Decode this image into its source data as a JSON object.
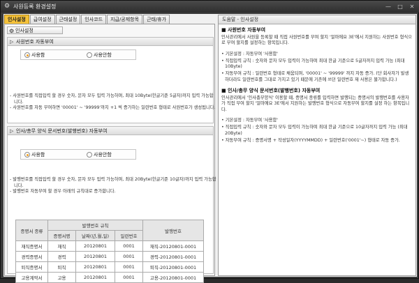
{
  "window": {
    "title": "사원등록 환경설정",
    "controls": [
      "—",
      "□",
      "✕"
    ]
  },
  "tabs": [
    {
      "label": "인사설정",
      "active": true
    },
    {
      "label": "급여설정",
      "active": false
    },
    {
      "label": "근태설정",
      "active": false
    },
    {
      "label": "인사코드",
      "active": false
    },
    {
      "label": "지급/공제항목",
      "active": false
    },
    {
      "label": "근태/휴가",
      "active": false
    }
  ],
  "left": {
    "section_title": "인사설정",
    "group1": {
      "title": "사원번호 자동부여",
      "radio_use": "사용함",
      "radio_nouse": "사용안함",
      "selected": "사용함",
      "notes": [
        "- 사원번호를 직접입력 할 경우 숫자, 문자 모두 입력 가능하며, 최대 10Byte(한글기준 5글자)까지 입력 가능합니다.",
        "- 사원번호를 자동 부여하면 '00001' ~ '99999'까지 +1 씩 증가하는 일련번호 형태로 사원번호가 생성됩니다."
      ]
    },
    "group2": {
      "title": "인사/총무 양식 문서번호(발행번호) 자동부여",
      "radio_use": "사용함",
      "radio_nouse": "사용안함",
      "selected": "사용함",
      "notes": [
        "- 발행번호를 직접입력 할 경우 숫자, 문자 모두 입력 가능하며, 최대 20Byte(한글기준 10글자)까지 입력 가능합니다.",
        "- 발행번호 자동부여 할 경우 아래의 규칙대로 증가합니다."
      ],
      "table": {
        "h_kind": "증명서 종류",
        "h_rule": "발행번호 규칙",
        "h_num": "발행번호",
        "h_short": "증명서명",
        "h_date": "날짜(년,월,일)",
        "h_serial": "일련번호",
        "rows": [
          {
            "kind": "재직증명서",
            "short": "재직",
            "date": "20120801",
            "serial": "0001",
            "num": "재직-20120801-0001"
          },
          {
            "kind": "경력증명서",
            "short": "경력",
            "date": "20120801",
            "serial": "0001",
            "num": "경력-20120801-0001"
          },
          {
            "kind": "퇴직증명서",
            "short": "퇴직",
            "date": "20120801",
            "serial": "0001",
            "num": "퇴직-20120801-0001"
          },
          {
            "kind": "고용계약서",
            "short": "고용",
            "date": "20120801",
            "serial": "0001",
            "num": "고용-20120801-0001"
          }
        ]
      }
    }
  },
  "help": {
    "title": "도움말 - 인사설정",
    "s1_title": "■ 사원번호 자동부여",
    "s1_desc": "인사관리에서 사원을 등록할 때 직접 사원번호를 부여 할지 '얼마에요 3E'에서 지원하는 사원번호 형식으로 부여 할지를 설정하는 항목입니다.",
    "s1_items": [
      "• 기본설정 : 자동부여 '사용함'",
      "• 직접입력 규칙 : 숫자와 문자 모두 입력이 가능하며 최대 한글 기준으로 5글자까지 입력 가능 (최대10Byte)",
      "• 자동부여 규칙 : 일련번호 형태로 채움되며, '00001' ~ '99999' 까지 자동 증가. (단 회사자가 발생하더라도 일련번호를 그대로 가지고 있기 때문에 기존에 쓰던 일련번호 재 사용은 불가합니다.)"
    ],
    "s2_title": "■ 인사/총무 양식 문서번호(발행번호) 자동부여",
    "s2_desc": "인사관리에서 '인사총무양식' 이용할 때, 증명서 종류를 입력하면 발행되는 증명서의 발행번호를 사용자가 직접 부여 할지 '얼마에요 3E'에서 지원하는 발행번호 형식으로 자동부여 할지를 설정 하는 항목입니다.",
    "s2_items": [
      "• 기본설정 : 자동부여 '사용함'",
      "• 직접입력 규칙 : 숫자와 문자 모두 입력이 가능하며 최대 한글 기준으로 10글자까지 입력 가능 (최대20Byte)",
      "• 자동부여 규칙 : 증명서명 + 작성일자(YYYYMMDD) + 일련번호('0001'~) 형태로 자동 증가."
    ]
  }
}
